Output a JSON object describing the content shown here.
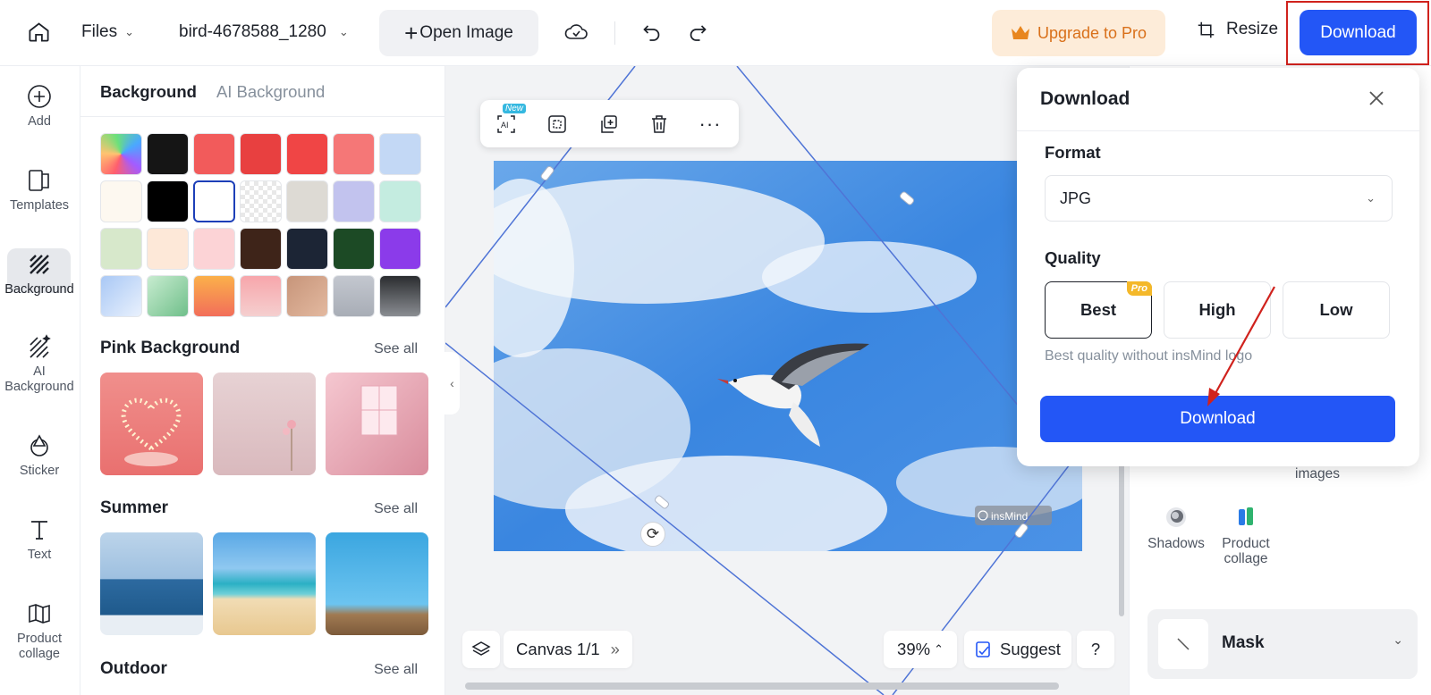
{
  "topbar": {
    "files_label": "Files",
    "filename": "bird-4678588_1280",
    "open_image_label": "Open Image",
    "upgrade_label": "Upgrade to Pro",
    "resize_label": "Resize",
    "download_label": "Download"
  },
  "rail": {
    "items": [
      {
        "label": "Add"
      },
      {
        "label": "Templates"
      },
      {
        "label": "Background"
      },
      {
        "label": "AI Background"
      },
      {
        "label": "Sticker"
      },
      {
        "label": "Text"
      },
      {
        "label": "Product collage"
      }
    ]
  },
  "panel": {
    "tab_background": "Background",
    "tab_ai_background": "AI Background",
    "swatch_colors": [
      "gradient-rainbow",
      "#151515",
      "#f25b5b",
      "#e84040",
      "#f04545",
      "#f57777",
      "#c3d8f5",
      "#fdf8f0",
      "#000000",
      "#ffffff",
      "transparent",
      "#dddad4",
      "#c2c3ee",
      "#c4ece0",
      "#d7e8cb",
      "#fde8d8",
      "#fcd3d6",
      "#3e2419",
      "#1c2535",
      "#1c4a25",
      "#8b3bea",
      "gradient-sky",
      "gradient-mint",
      "gradient-orange",
      "gradient-pink",
      "gradient-tan",
      "gradient-silver",
      "gradient-dark"
    ],
    "sections": [
      {
        "title": "Pink Background",
        "see_all": "See all"
      },
      {
        "title": "Summer",
        "see_all": "See all"
      },
      {
        "title": "Outdoor",
        "see_all": "See all"
      }
    ]
  },
  "canvas": {
    "canvas_label": "Canvas 1/1",
    "zoom": "39%",
    "suggest_label": "Suggest",
    "help_label": "?",
    "new_badge": "New",
    "watermark": "insMind"
  },
  "right_panel": {
    "tools": [
      {
        "label": "images"
      },
      {
        "label": "Shadows"
      },
      {
        "label": "Product collage"
      }
    ],
    "mask_label": "Mask"
  },
  "popup": {
    "title": "Download",
    "format_label": "Format",
    "format_value": "JPG",
    "quality_label": "Quality",
    "quality_options": [
      "Best",
      "High",
      "Low"
    ],
    "quality_selected": "Best",
    "pro_badge": "Pro",
    "quality_desc": "Best quality without insMind logo",
    "download_button": "Download"
  }
}
